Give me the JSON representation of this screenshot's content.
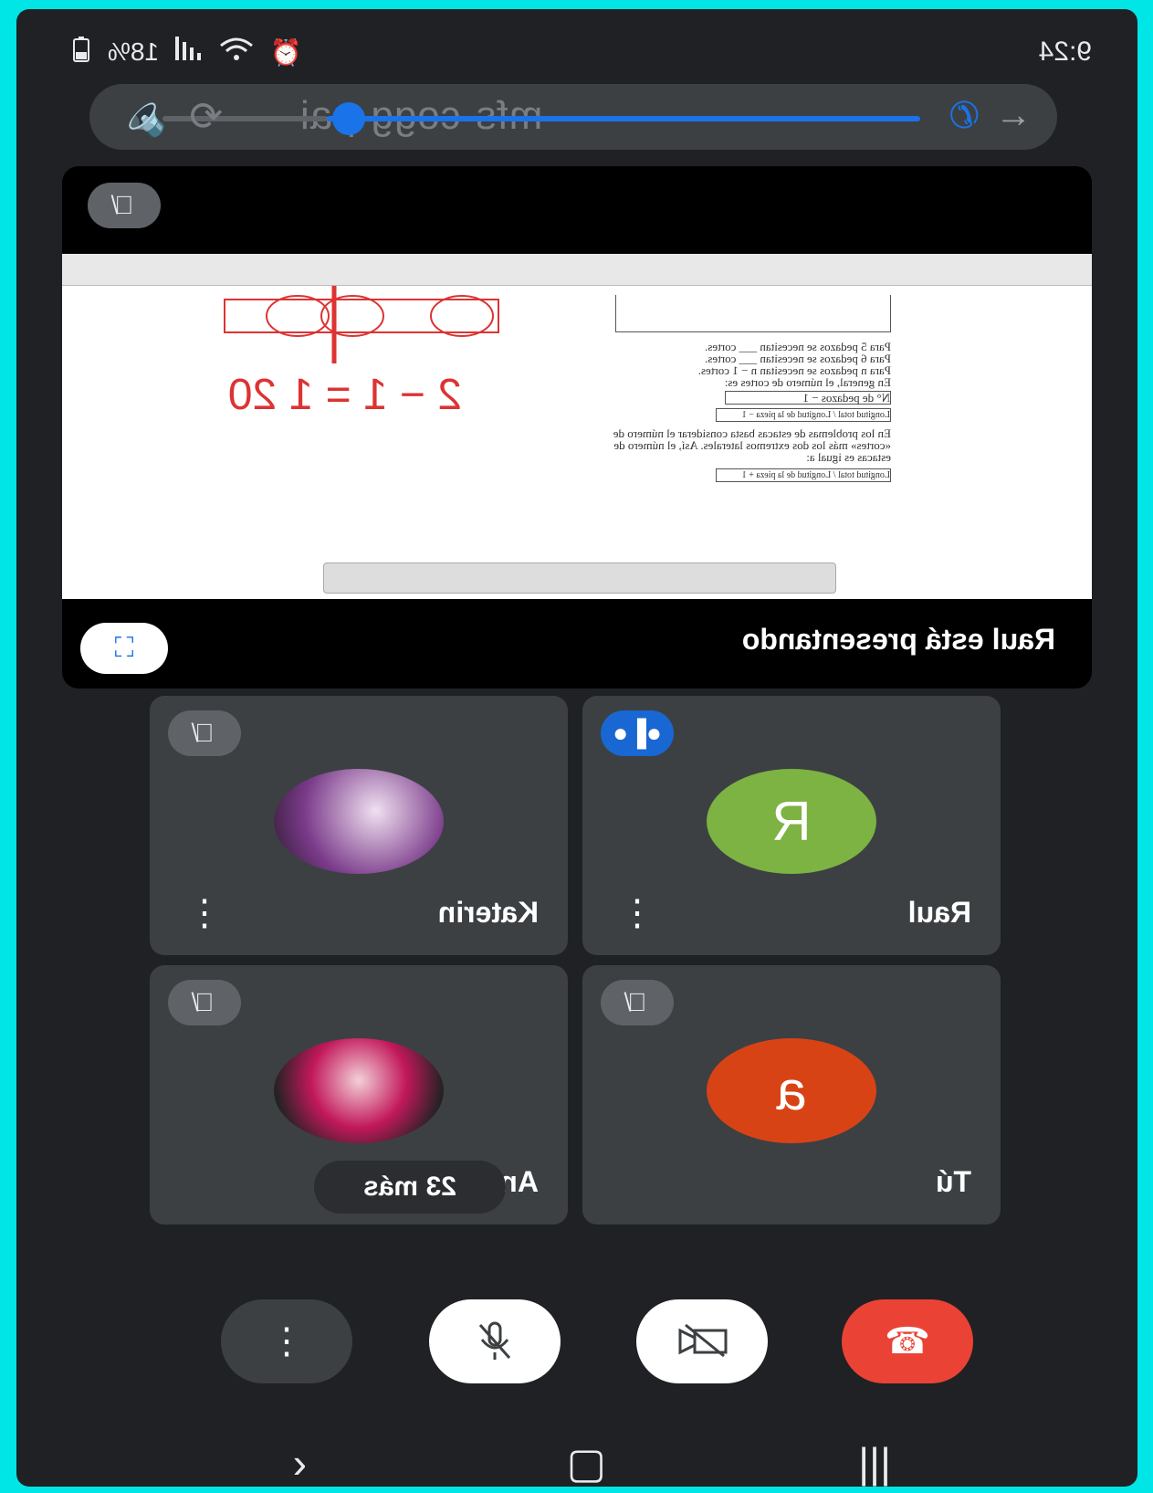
{
  "status": {
    "time": "9:24",
    "battery": "18%"
  },
  "toolbar": {
    "meeting_code": "mfs-cogg-pai"
  },
  "presentation": {
    "caption": "Raul está presentando",
    "whiteboard_lines": [
      "Para 5 pedazos se necesitan ___ cortes.",
      "Para 6 pedazos se necesitan ___ cortes.",
      "Para n pedazos se necesitan n − 1 cortes.",
      "En general, el número de cortes es:"
    ],
    "whiteboard_formula": "N° de pedazos − 1",
    "whiteboard_box1": "Longitud total / Longitud de la pieza − 1",
    "whiteboard_paragraph": "En los problemas de estacas basta considerar el número de «cortes» más los dos extremos laterales. Así, el número de estacas es igual a:",
    "whiteboard_box2": "Longitud total / Longitud de la pieza + 1",
    "handwriting": "2 − 1 = 1 20"
  },
  "participants": [
    {
      "name": "Raul",
      "initial": "R",
      "color": "#7cb342",
      "speaking": true
    },
    {
      "name": "Katerin",
      "initial": "",
      "color": "#b0a0b8",
      "muted": true
    },
    {
      "name": "Tú",
      "initial": "a",
      "color": "#d84315",
      "muted": true
    },
    {
      "name": "Analuz yiun",
      "initial": "",
      "color": "#c8a8a0",
      "muted": true
    }
  ],
  "more_participants": "23 más",
  "controls": {
    "hangup_color": "#ea4335",
    "accent": "#1a73e8"
  }
}
